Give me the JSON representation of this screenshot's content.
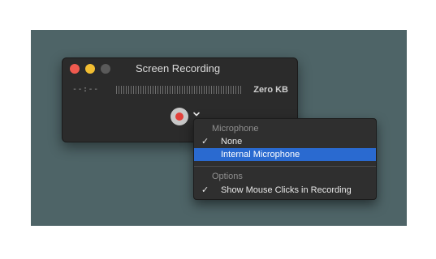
{
  "window": {
    "title": "Screen Recording",
    "elapsed_time": "--:--",
    "file_size": "Zero KB"
  },
  "menu": {
    "sections": [
      {
        "header": "Microphone",
        "items": [
          {
            "label": "None",
            "checked": true,
            "highlighted": false
          },
          {
            "label": "Internal Microphone",
            "checked": false,
            "highlighted": true
          }
        ]
      },
      {
        "header": "Options",
        "items": [
          {
            "label": "Show Mouse Clicks in Recording",
            "checked": true,
            "highlighted": false
          }
        ]
      }
    ],
    "check_glyph": "✓"
  },
  "icons": {
    "close": "close-button-icon",
    "minimize": "minimize-button-icon",
    "zoom": "zoom-button-icon",
    "record": "record-icon",
    "options": "chevron-down-icon"
  },
  "colors": {
    "desktop": "#4e6467",
    "window": "#2b2b2b",
    "close": "#ef5a4f",
    "minimize": "#f2be32",
    "zoom_disabled": "#5a5a5a",
    "record_dot": "#e2403a",
    "highlight": "#2a6ad0"
  }
}
